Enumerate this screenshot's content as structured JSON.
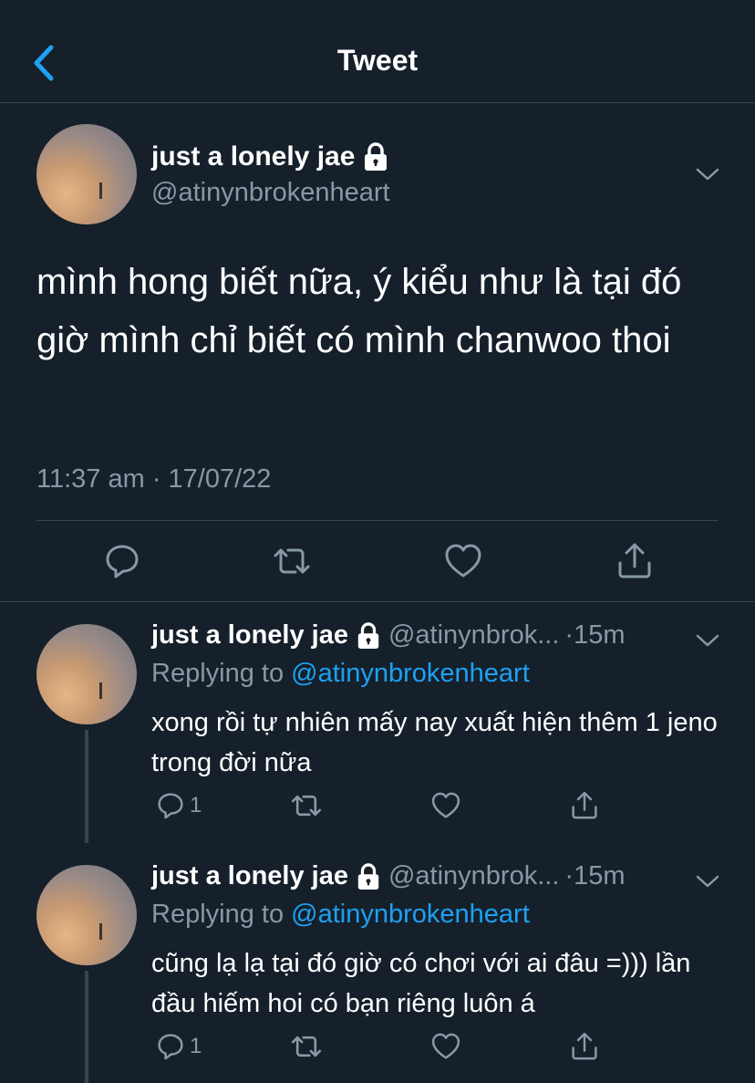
{
  "header": {
    "title": "Tweet"
  },
  "main_tweet": {
    "author_name": "just a lonely jae",
    "handle": "@atinynbrokenheart",
    "text": "mình hong biết nữa, ý kiểu như là tại đó giờ mình chỉ biết có mình chanwoo thoi",
    "timestamp": "11:37 am · 17/07/22",
    "icons": [
      "reply-icon",
      "retweet-icon",
      "like-icon",
      "share-icon"
    ]
  },
  "replies": [
    {
      "author_name": "just a lonely jae",
      "handle": "@atinynbrok...",
      "time": "·15m",
      "replying_label": "Replying to",
      "replying_to": "@atinynbrokenheart",
      "text": "xong rồi tự nhiên mấy nay xuất hiện thêm 1 jeno trong đời nữa",
      "reply_count": "1"
    },
    {
      "author_name": "just a lonely jae",
      "handle": "@atinynbrok...",
      "time": "·15m",
      "replying_label": "Replying to",
      "replying_to": "@atinynbrokenheart",
      "text": "cũng lạ lạ tại đó giờ có chơi với ai đâu =))) lần đầu hiếm hoi có bạn riêng luôn á",
      "reply_count": "1"
    }
  ],
  "colors": {
    "background": "#15202b",
    "text": "#ffffff",
    "muted": "#8899a6",
    "accent": "#1da1f2",
    "divider": "#38444d"
  }
}
